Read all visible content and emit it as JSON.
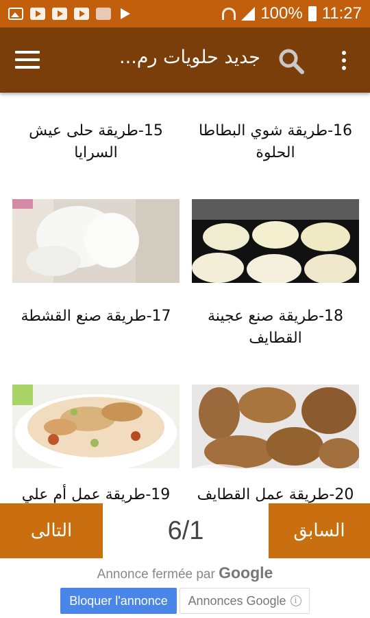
{
  "status_bar": {
    "battery": "100%",
    "time": "11:27",
    "icons": [
      "image-icon",
      "youtube-icon",
      "youtube-icon",
      "youtube-icon",
      "photo-thumbnail-icon",
      "play-store-icon",
      "wifi-icon",
      "signal-icon",
      "battery-icon"
    ]
  },
  "toolbar": {
    "title": "جديد حلويات رم...",
    "color": "#7a3e0a",
    "icons": [
      "menu-icon",
      "search-icon",
      "more-vert-icon"
    ]
  },
  "cards": [
    {
      "title": "16-طريقة شوي البطاطا الحلوة",
      "image": "sweet-potato-pancakes"
    },
    {
      "title": "15-طريقة حلى عيش السرايا",
      "image": "white-cream-flour"
    },
    {
      "title": "18-طريقة صنع عجينة القطايف",
      "image": "qatayef-pan"
    },
    {
      "title": "17-طريقة صنع القشطة",
      "image": "nut-dessert-bowl"
    },
    {
      "title": "20-طريقة عمل القطايف",
      "image": "fried-qatayef"
    },
    {
      "title": "19-طريقة عمل أم علي",
      "image": ""
    }
  ],
  "pager": {
    "next_label": "التالى",
    "prev_label": "السابق",
    "page": "6/1",
    "accent": "#c96f10"
  },
  "ad": {
    "closed_text": "Annonce fermée par",
    "google": "Google",
    "block_label": "Bloquer l'annonce",
    "ads_label": "Annonces Google"
  }
}
